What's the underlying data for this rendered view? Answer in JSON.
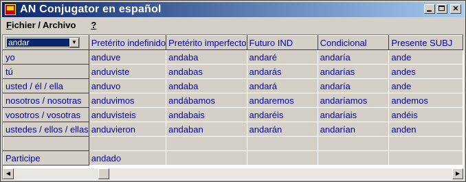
{
  "window": {
    "title": "AN  Conjugator en español"
  },
  "menu": [
    {
      "label": "Fichier / Archivo",
      "accel": "F"
    },
    {
      "label": "?",
      "accel": "?"
    }
  ],
  "verb_select": {
    "value": "andar"
  },
  "columns": [
    "Pretérito indefinido",
    "Pretérito imperfecto",
    "Futuro IND",
    "Condicional",
    "Presente SUBJ"
  ],
  "rows": [
    {
      "label": "yo",
      "cells": [
        "anduve",
        "andaba",
        "andaré",
        "andaría",
        "ande"
      ]
    },
    {
      "label": "tú",
      "cells": [
        "anduviste",
        "andabas",
        "andarás",
        "andarías",
        "andes"
      ]
    },
    {
      "label": "usted / él / ella",
      "cells": [
        "anduvo",
        "andaba",
        "andará",
        "andaría",
        "ande"
      ]
    },
    {
      "label": "nosotros / nosotras",
      "cells": [
        "anduvimos",
        "andábamos",
        "andaremos",
        "andaríamos",
        "andemos"
      ]
    },
    {
      "label": "vosotros / vosotras",
      "cells": [
        "anduvisteis",
        "andabais",
        "andaréis",
        "andaríais",
        "andéis"
      ]
    },
    {
      "label": "ustedes / ellos / ellas",
      "cells": [
        "anduvieron",
        "andaban",
        "andarán",
        "andarían",
        "anden"
      ]
    },
    {
      "label": "",
      "cells": [
        "",
        "",
        "",
        "",
        ""
      ]
    },
    {
      "label": "Participe",
      "cells": [
        "andado",
        "",
        "",
        "",
        ""
      ]
    }
  ]
}
